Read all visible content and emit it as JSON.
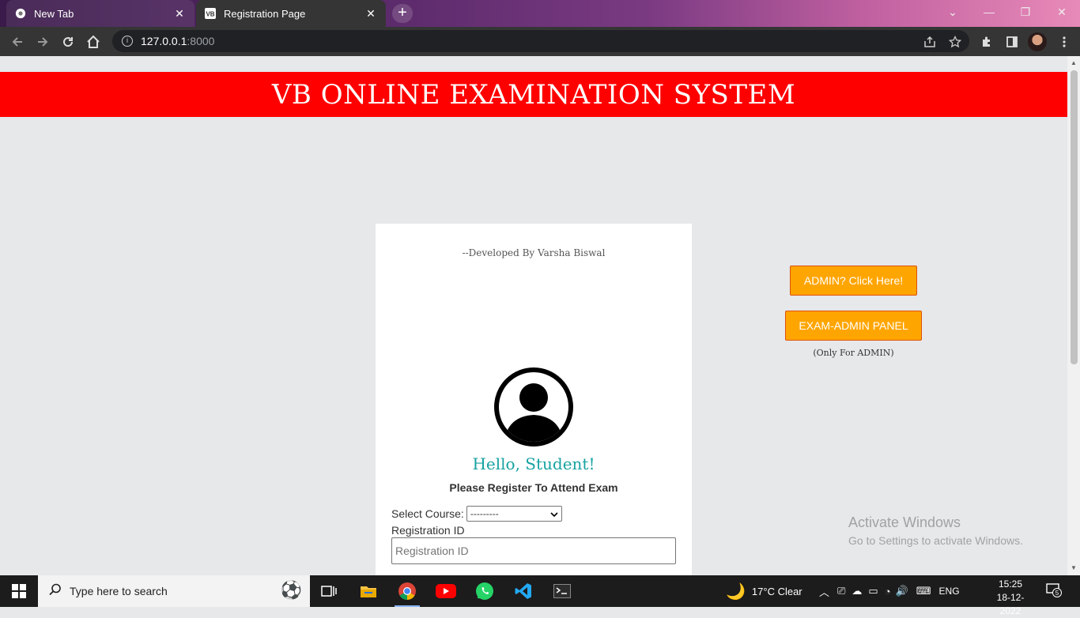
{
  "browser": {
    "tabs": [
      {
        "title": "New Tab",
        "close": "✕"
      },
      {
        "title": "Registration Page",
        "close": "✕",
        "favicon_text": "VB"
      }
    ],
    "new_tab_symbol": "+",
    "address": {
      "host": "127.0.0.1",
      "port": ":8000"
    },
    "window_controls": {
      "menu": "⌄",
      "minimize": "—",
      "restore": "❐",
      "close": "✕"
    }
  },
  "page": {
    "header_title": "VB ONLINE EXAMINATION SYSTEM",
    "developer_credit": "--Developed By Varsha Biswal",
    "greeting": "Hello, Student!",
    "instruction": "Please Register To Attend Exam",
    "course_label": "Select Course:",
    "course_selected": "---------",
    "registration_label": "Registration ID",
    "registration_placeholder": "Registration ID",
    "admin_button": "ADMIN? Click Here!",
    "exam_admin_button": "EXAM-ADMIN PANEL",
    "admin_note": "(Only For ADMIN)"
  },
  "watermark": {
    "title": "Activate Windows",
    "subtitle": "Go to Settings to activate Windows."
  },
  "taskbar": {
    "search_placeholder": "Type here to search",
    "weather": "17°C  Clear",
    "language": "ENG",
    "time": "15:25",
    "date": "18-12-2022",
    "notification_count": "5"
  },
  "colors": {
    "header_red": "#ff0000",
    "button_orange": "#ffa500",
    "greeting_teal": "#17a2a2"
  }
}
